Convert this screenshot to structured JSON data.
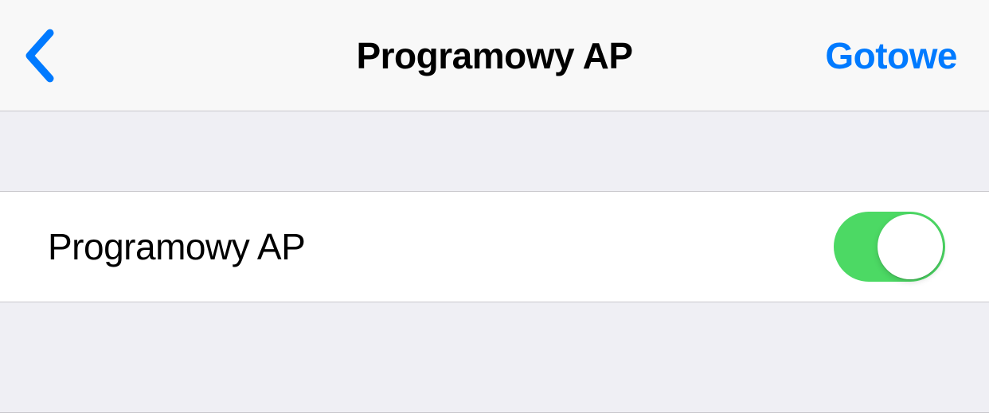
{
  "navbar": {
    "title": "Programowy AP",
    "done_label": "Gotowe"
  },
  "settings": {
    "softap": {
      "label": "Programowy AP",
      "enabled": true
    }
  },
  "colors": {
    "accent": "#007AFF",
    "toggle_on": "#4CD964"
  },
  "icons": {
    "back": "chevron-left"
  }
}
